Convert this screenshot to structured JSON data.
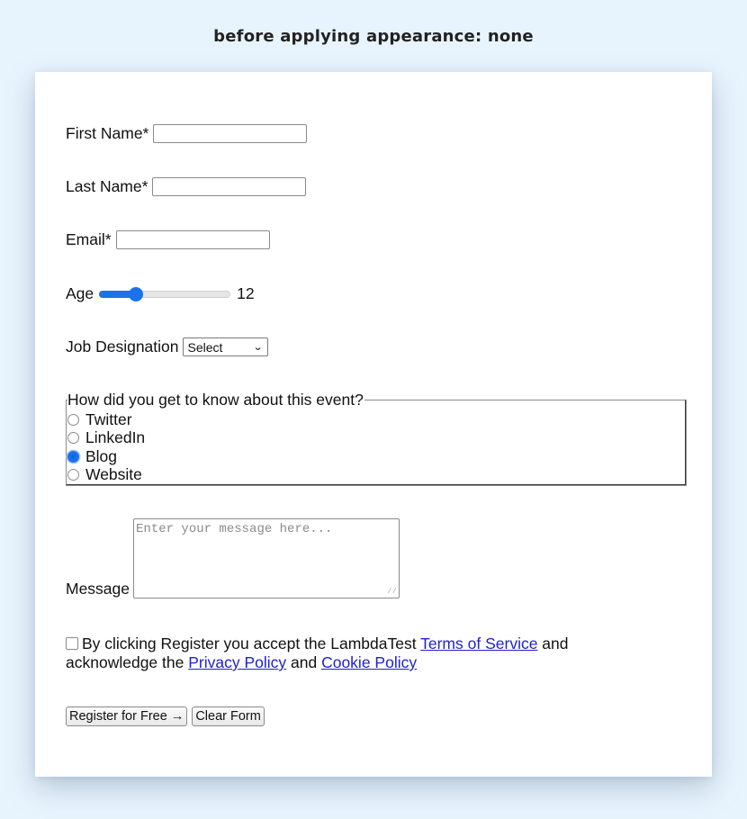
{
  "caption": "before applying appearance: none",
  "form": {
    "first_name": {
      "label": "First Name*",
      "value": ""
    },
    "last_name": {
      "label": "Last Name*",
      "value": ""
    },
    "email": {
      "label": "Email*",
      "value": ""
    },
    "age": {
      "label": "Age",
      "value": 12,
      "min": 0,
      "max": 100,
      "display": "12"
    },
    "job": {
      "label": "Job Designation",
      "selected": "Select",
      "chevron": "⌄"
    },
    "source": {
      "legend": "How did you get to know about this event?",
      "options": [
        {
          "label": "Twitter",
          "checked": false
        },
        {
          "label": "LinkedIn",
          "checked": false
        },
        {
          "label": "Blog",
          "checked": true
        },
        {
          "label": "Website",
          "checked": false
        }
      ]
    },
    "message": {
      "label": "Message",
      "placeholder": "Enter your message here...",
      "value": ""
    },
    "terms": {
      "checked": false,
      "text_1": "By clicking Register you accept the LambdaTest ",
      "link_terms": "Terms of Service",
      "text_2": " and acknowledge the ",
      "link_privacy": "Privacy Policy",
      "text_3": " and ",
      "link_cookie": "Cookie Policy"
    },
    "buttons": {
      "register": "Register for Free →",
      "clear": "Clear Form"
    }
  },
  "colors": {
    "accent": "#1a73e8",
    "link": "#2222cc",
    "background": "#e8f4fd"
  }
}
